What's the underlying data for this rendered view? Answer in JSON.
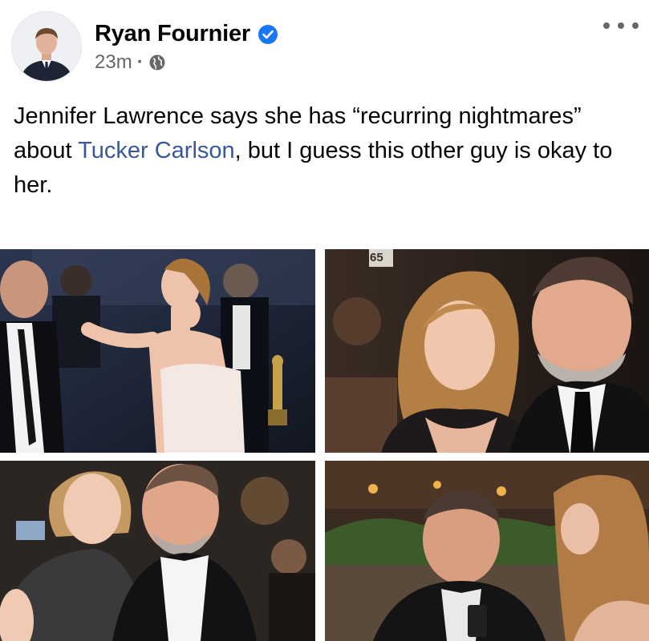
{
  "post": {
    "author": "Ryan Fournier",
    "time": "23m",
    "dot": "·",
    "text_before": "Jennifer Lawrence says she has “recurring nightmares” about ",
    "link_text": "Tucker Carlson",
    "text_after": ", but I guess this other guy is okay to her.",
    "photo_overlay_text": "65"
  },
  "icons": {
    "verified": "verified-badge-icon",
    "audience": "globe-icon",
    "more": "more-options-icon"
  },
  "colors": {
    "name": "#050505",
    "meta": "#65676b",
    "link": "#385898",
    "verified": "#1877f2"
  }
}
